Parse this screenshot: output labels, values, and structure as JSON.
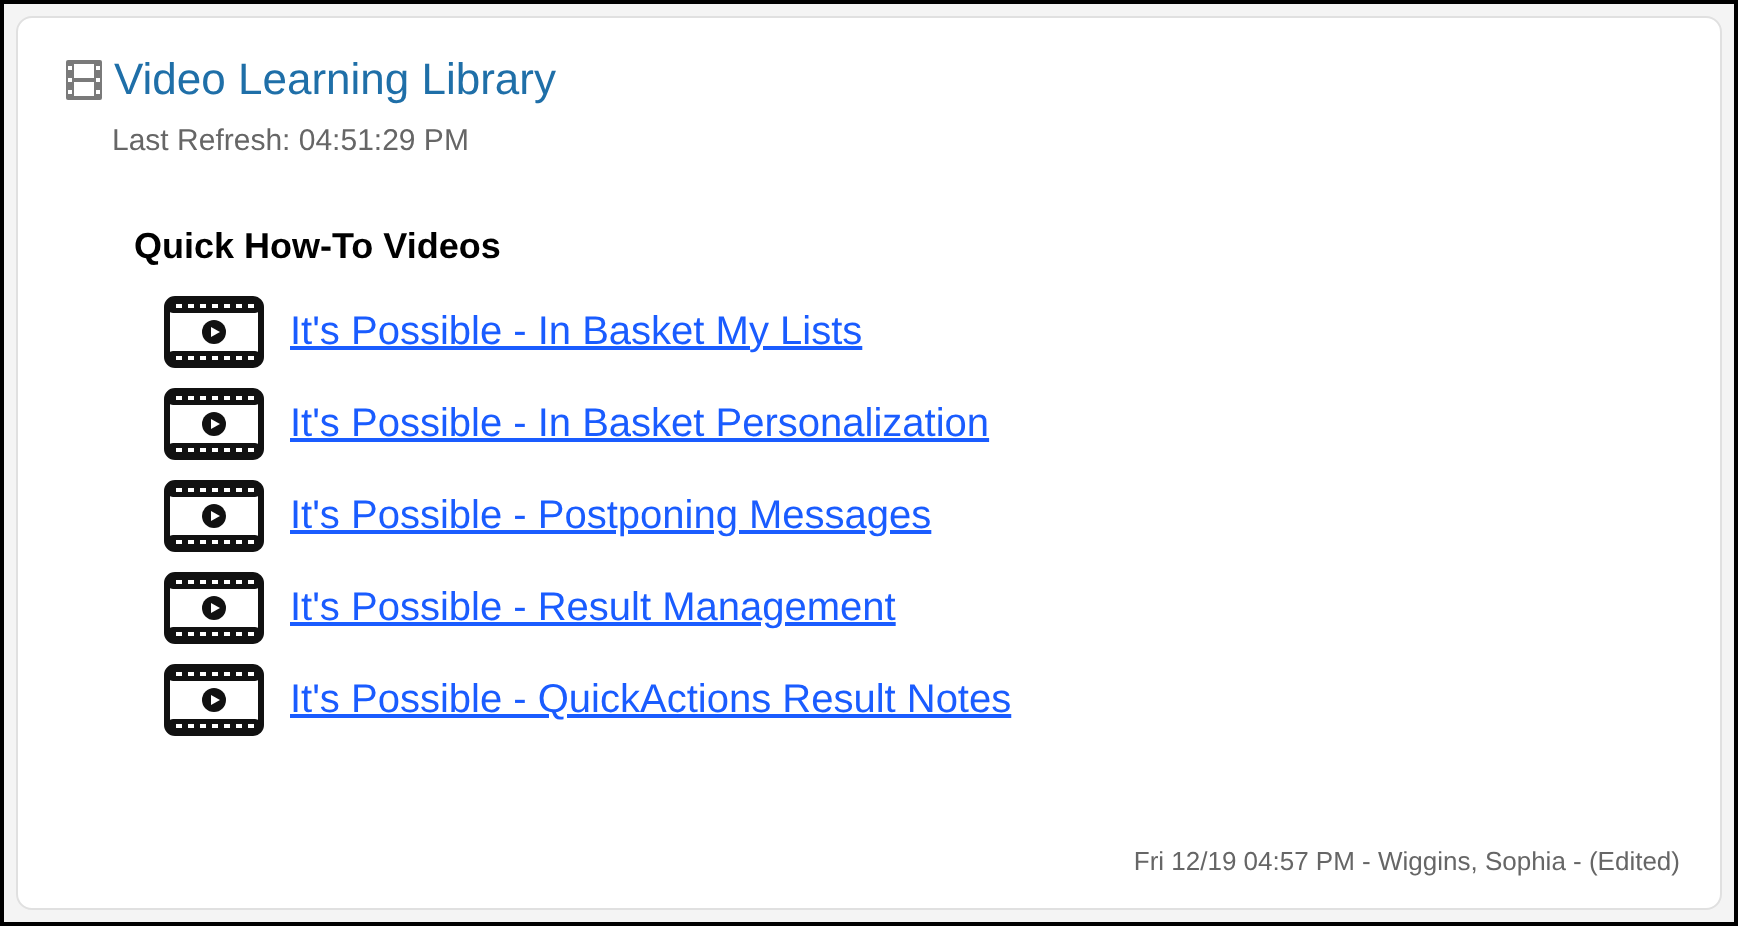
{
  "panel": {
    "title": "Video Learning Library",
    "last_refresh": "Last Refresh: 04:51:29 PM"
  },
  "section": {
    "heading": "Quick How-To Videos",
    "videos": [
      {
        "label": "It's Possible - In Basket My Lists"
      },
      {
        "label": "It's Possible - In Basket Personalization"
      },
      {
        "label": "It's Possible - Postponing Messages"
      },
      {
        "label": "It's Possible - Result Management"
      },
      {
        "label": "It's Possible - QuickActions Result Notes"
      }
    ]
  },
  "footer": "Fri 12/19 04:57 PM - Wiggins, Sophia - (Edited)"
}
